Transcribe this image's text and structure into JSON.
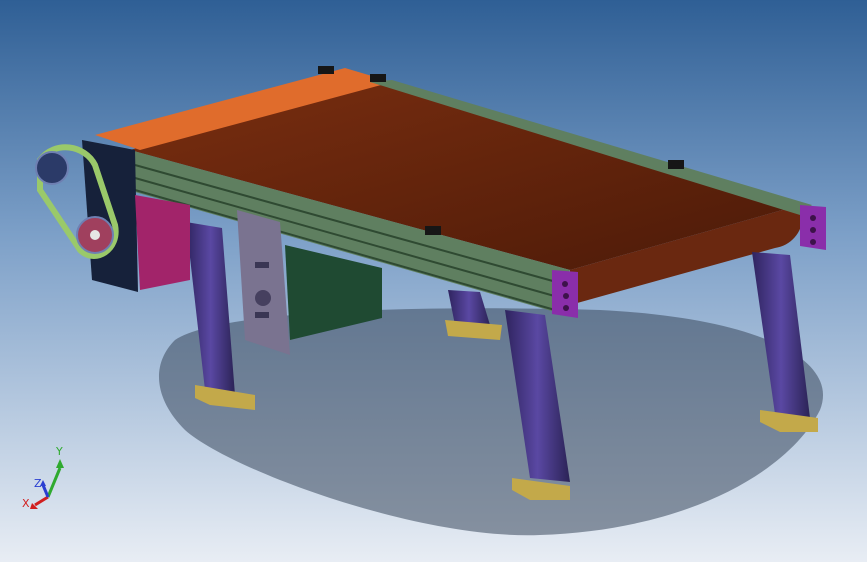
{
  "viewport": {
    "background_top": "#2f5f95",
    "background_bottom": "#e8edf4"
  },
  "model": {
    "belt_color": "#5a220c",
    "frame_color": "#5f7f60",
    "end_cap_color": "#8a2eaa",
    "leg_color": "#4c3a8a",
    "foot_color": "#c3a94a",
    "motor_color": "#1f4a32",
    "guard_color": "#e06c2c",
    "drive_cover_color": "#16213a"
  },
  "triad": {
    "x_label": "X",
    "y_label": "Y",
    "z_label": "Z",
    "x_color": "#d11f1f",
    "y_color": "#2faa2f",
    "z_color": "#2a3fd1"
  }
}
